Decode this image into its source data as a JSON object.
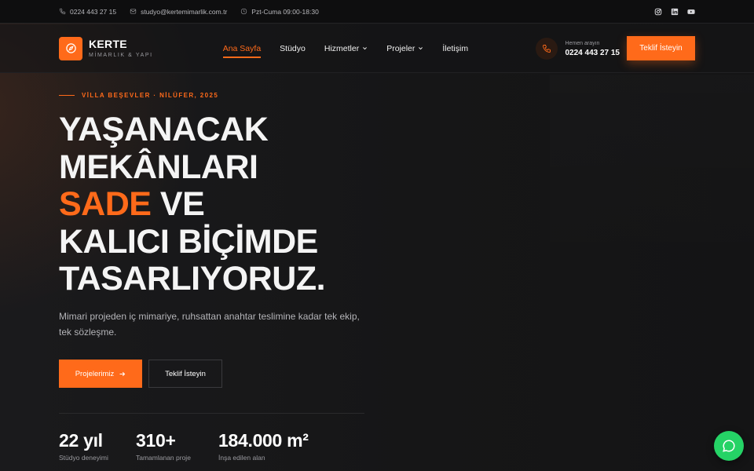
{
  "topbar": {
    "phone": "0224 443 27 15",
    "email": "studyo@kertemimarlik.com.tr",
    "hours": "Pzt-Cuma 09:00-18:30",
    "social": [
      "instagram-icon",
      "linkedin-icon",
      "youtube-icon"
    ]
  },
  "brand": {
    "name": "KERTE",
    "tagline": "MİMARLIK & YAPI",
    "accent": "#ff6a1a"
  },
  "nav": {
    "items": [
      {
        "label": "Ana Sayfa",
        "active": true
      },
      {
        "label": "Stüdyo"
      },
      {
        "label": "Hizmetler",
        "dropdown": true
      },
      {
        "label": "Projeler",
        "dropdown": true
      },
      {
        "label": "İletişim"
      }
    ],
    "call_label": "Hemen arayın",
    "call_number": "0224 443 27 15",
    "cta": "Teklif İsteyin"
  },
  "hero": {
    "eyebrow": "VİLLA BEŞEVLER · NİLÜFER, 2025",
    "headline_1": "YAŞANACAK",
    "headline_2": "MEKÂNLARI",
    "headline_accent": "SADE",
    "headline_3": " VE",
    "headline_4": "KALICI BİÇİMDE",
    "headline_5": "TASARLIYORUZ.",
    "lead": "Mimari projeden iç mimariye, ruhsattan anahtar teslimine kadar tek ekip, tek sözleşme.",
    "primary_btn": "Projelerimiz",
    "secondary_btn": "Teklif İsteyin"
  },
  "stats": [
    {
      "value": "22 yıl",
      "label": "Stüdyo deneyimi"
    },
    {
      "value": "310+",
      "label": "Tamamlanan proje"
    },
    {
      "value": "184.000 m²",
      "label": "İnşa edilen alan"
    }
  ],
  "chat": {
    "icon": "chat-icon",
    "color": "#25d366"
  }
}
